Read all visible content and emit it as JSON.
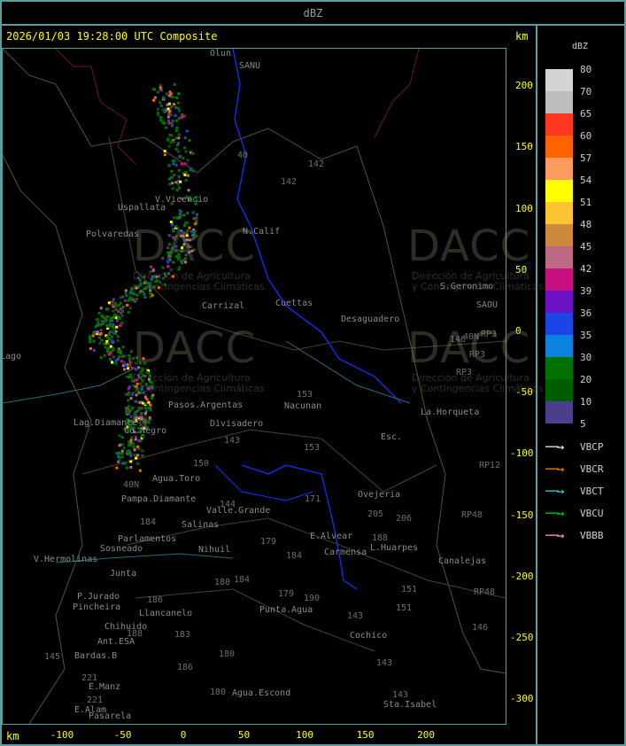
{
  "header": {
    "title": "dBZ"
  },
  "map": {
    "timestamp": "2026/01/03 19:28:00 UTC Composite",
    "unit_top": "km",
    "unit_bottom": "km",
    "x_ticks": [
      "-100",
      "-50",
      "0",
      "50",
      "100",
      "150",
      "200"
    ],
    "y_ticks": [
      "200",
      "150",
      "100",
      "50",
      "0",
      "-50",
      "-100",
      "-150",
      "-200",
      "-250",
      "-300"
    ],
    "watermark": {
      "brand": "DACC",
      "line1": "Dirección de Agricultura",
      "line2": "y Contingencias Climáticas"
    },
    "places": [
      "Uspallata",
      "Polvaredas",
      "V.Vicencio",
      "N.Calif",
      "Cuettas",
      "Carrizal",
      "Desaguadero",
      "S.Geronimo",
      "Nacunan",
      "La.Horqueta",
      "Lag.Diamante",
      "Co.Negro",
      "Divisadero",
      "Pasos.Argentas",
      "Agua.Toro",
      "Pampa.Diamante",
      "Valle.Grande",
      "Salinas",
      "Parlamentos",
      "Sosneado",
      "Nihuil",
      "V.Hermolinas",
      "Junta",
      "P.Jurado",
      "Pincheira",
      "Llancanelo",
      "Chihuido",
      "Ant.ESA",
      "Bardas.B",
      "E.Manz",
      "E.Alam",
      "Pasarela",
      "Agua.Escond",
      "Punta.Agua",
      "Carmensa",
      "L.Huarpes",
      "Ovejeria",
      "Canalejas",
      "Cochico",
      "Sta.Isabel",
      "Esc.",
      "Olun",
      "SANU",
      "SAOU",
      "Lago",
      "E.Alvear"
    ],
    "roads": [
      "40",
      "142",
      "142",
      "153",
      "153",
      "146",
      "143",
      "150",
      "144",
      "179",
      "184",
      "180",
      "184",
      "179",
      "190",
      "143",
      "151",
      "151",
      "143",
      "186",
      "183",
      "180",
      "180",
      "143",
      "145",
      "221",
      "188",
      "206",
      "205",
      "171",
      "RP3",
      "RP3",
      "RP3",
      "RP12",
      "RP48",
      "RP48",
      "146",
      "40N",
      "40N",
      "40N",
      "184",
      "186",
      "188",
      "221"
    ]
  },
  "legend": {
    "title": "dBZ",
    "levels": [
      "80",
      "70",
      "65",
      "60",
      "57",
      "54",
      "51",
      "48",
      "45",
      "42",
      "39",
      "36",
      "35",
      "30",
      "20",
      "10",
      "5"
    ],
    "colors": [
      "#d4d4d4",
      "#bdbdbd",
      "#ff3820",
      "#ff6200",
      "#ff9b5e",
      "#ffff00",
      "#fbc531",
      "#cd8a3c",
      "#bd6884",
      "#c7107f",
      "#6c12c5",
      "#1c45e8",
      "#0b82de",
      "#007200",
      "#005d00",
      "#4b3f8c"
    ],
    "radars": [
      {
        "name": "VBCP",
        "color": "#ffffff"
      },
      {
        "name": "VBCR",
        "color": "#ff8c00"
      },
      {
        "name": "VBCT",
        "color": "#40e0e0"
      },
      {
        "name": "VBCU",
        "color": "#00e000"
      },
      {
        "name": "VBBB",
        "color": "#ffb0c0"
      }
    ]
  }
}
